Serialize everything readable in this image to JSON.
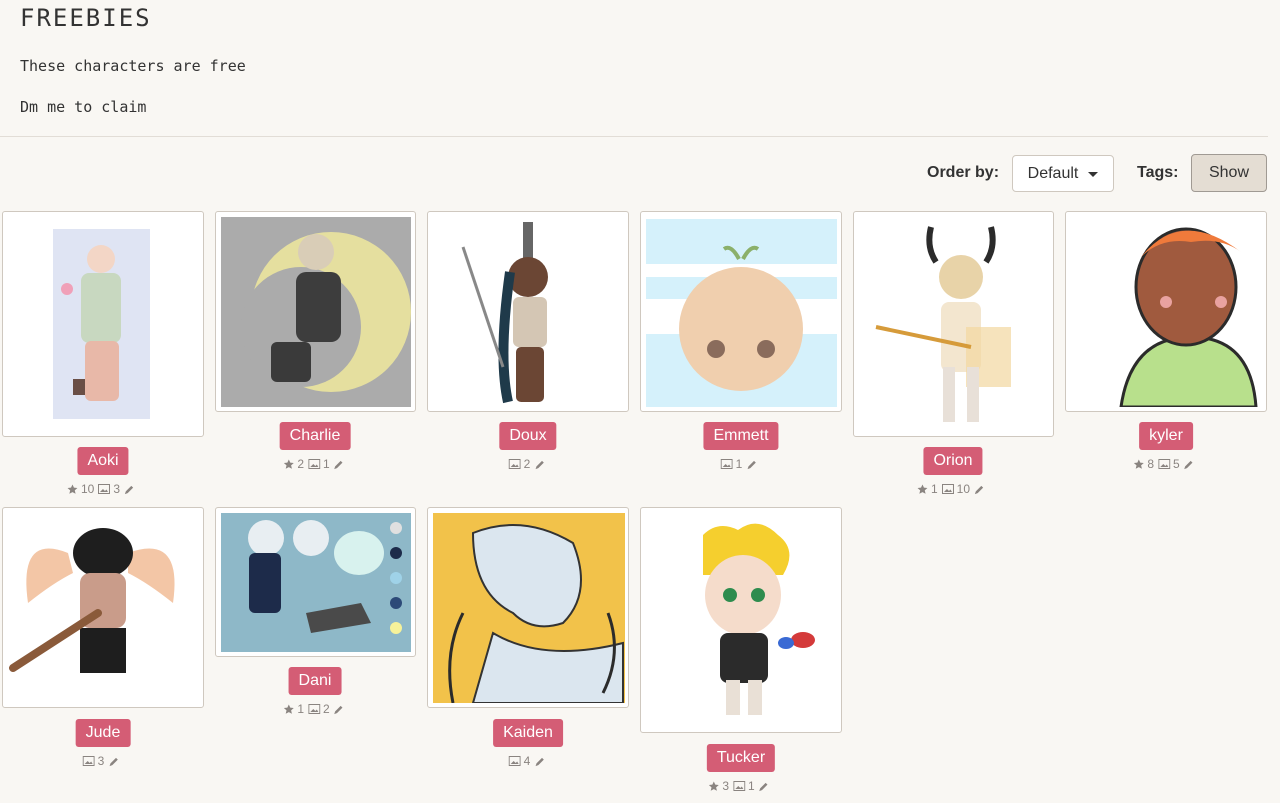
{
  "header": {
    "title": "FREEBIES",
    "line1": "These characters are free",
    "line2": "Dm me to claim"
  },
  "toolbar": {
    "order_label": "Order by:",
    "order_value": "Default",
    "tags_label": "Tags:",
    "tags_button": "Show"
  },
  "characters": [
    {
      "name": "Aoki",
      "favorites": "10",
      "images": "3"
    },
    {
      "name": "Charlie",
      "favorites": "2",
      "images": "1"
    },
    {
      "name": "Doux",
      "favorites": "",
      "images": "2"
    },
    {
      "name": "Emmett",
      "favorites": "",
      "images": "1"
    },
    {
      "name": "Orion",
      "favorites": "1",
      "images": "10"
    },
    {
      "name": "kyler",
      "favorites": "8",
      "images": "5"
    },
    {
      "name": "Jude",
      "favorites": "",
      "images": "3"
    },
    {
      "name": "Dani",
      "favorites": "1",
      "images": "2"
    },
    {
      "name": "Kaiden",
      "favorites": "",
      "images": "4"
    },
    {
      "name": "Tucker",
      "favorites": "3",
      "images": "1"
    }
  ],
  "colors": {
    "badge": "#d45d75",
    "background": "#f9f7f3",
    "stats": "#8a8480"
  }
}
